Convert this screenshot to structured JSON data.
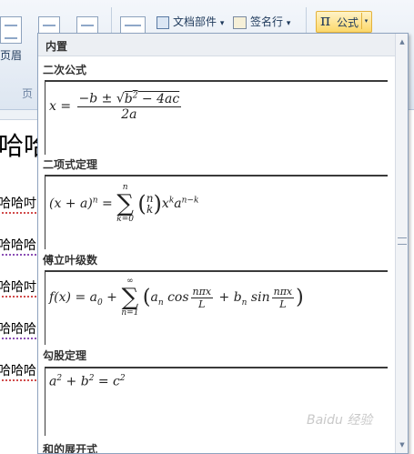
{
  "ribbon": {
    "header_label": "页眉",
    "header_group_partial": "页",
    "docparts_label": "文档部件",
    "signature_label": "签名行",
    "equation_label": "公式",
    "equation_symbol": "π",
    "dropdown_caret": "▾"
  },
  "document": {
    "lines": [
      "哈哈",
      "哈哈吋",
      "哈哈哈",
      "哈哈吋",
      "哈哈哈",
      "哈哈哈"
    ]
  },
  "gallery": {
    "header": "内置",
    "sections": [
      {
        "label": "二次公式",
        "formula": "x = (−b ± √(b² − 4ac)) / 2a"
      },
      {
        "label": "二项式定理",
        "formula": "(x + a)^n = Σ_{k=0}^{n} (n k) x^k a^{n−k}"
      },
      {
        "label": "傅立叶级数",
        "formula": "f(x) = a₀ + Σ_{n=1}^{∞} (a_n cos(nπx/L) + b_n sin(nπx/L))"
      },
      {
        "label": "勾股定理",
        "formula": "a² + b² = c²"
      },
      {
        "label": "和的展开式",
        "formula": ""
      }
    ]
  },
  "scrollbar": {
    "up": "▲",
    "down": "▼"
  },
  "watermark": "Baidu 经验"
}
